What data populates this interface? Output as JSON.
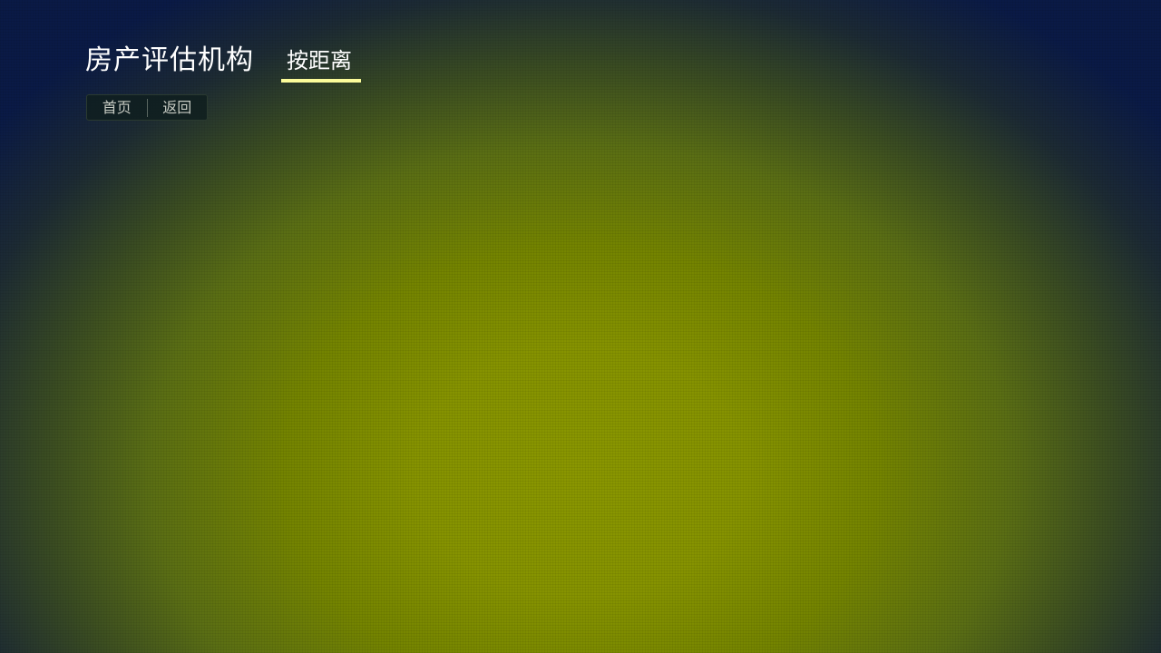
{
  "header": {
    "title": "房产评估机构",
    "active_tab": "按距离"
  },
  "nav": {
    "home_label": "首页",
    "back_label": "返回"
  },
  "colors": {
    "tab_underline": "#fbfb9a",
    "background_center": "#8a9700",
    "background_edge": "#0a1a46"
  }
}
